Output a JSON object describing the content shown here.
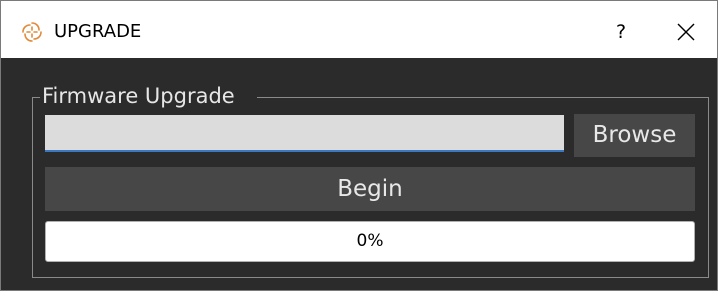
{
  "window": {
    "title": "UPGRADE",
    "help_label": "?",
    "icon": "app-logo-icon",
    "close_icon": "close-icon"
  },
  "firmware_group": {
    "title": "Firmware Upgrade",
    "path_value": "",
    "path_placeholder": "",
    "browse_label": "Browse",
    "begin_label": "Begin",
    "progress_text": "0%",
    "progress_value": 0
  },
  "colors": {
    "body_bg": "#2b2b2b",
    "button_bg": "#474747",
    "field_bg": "#dcdcdc",
    "focus_accent": "#3b78c2"
  }
}
